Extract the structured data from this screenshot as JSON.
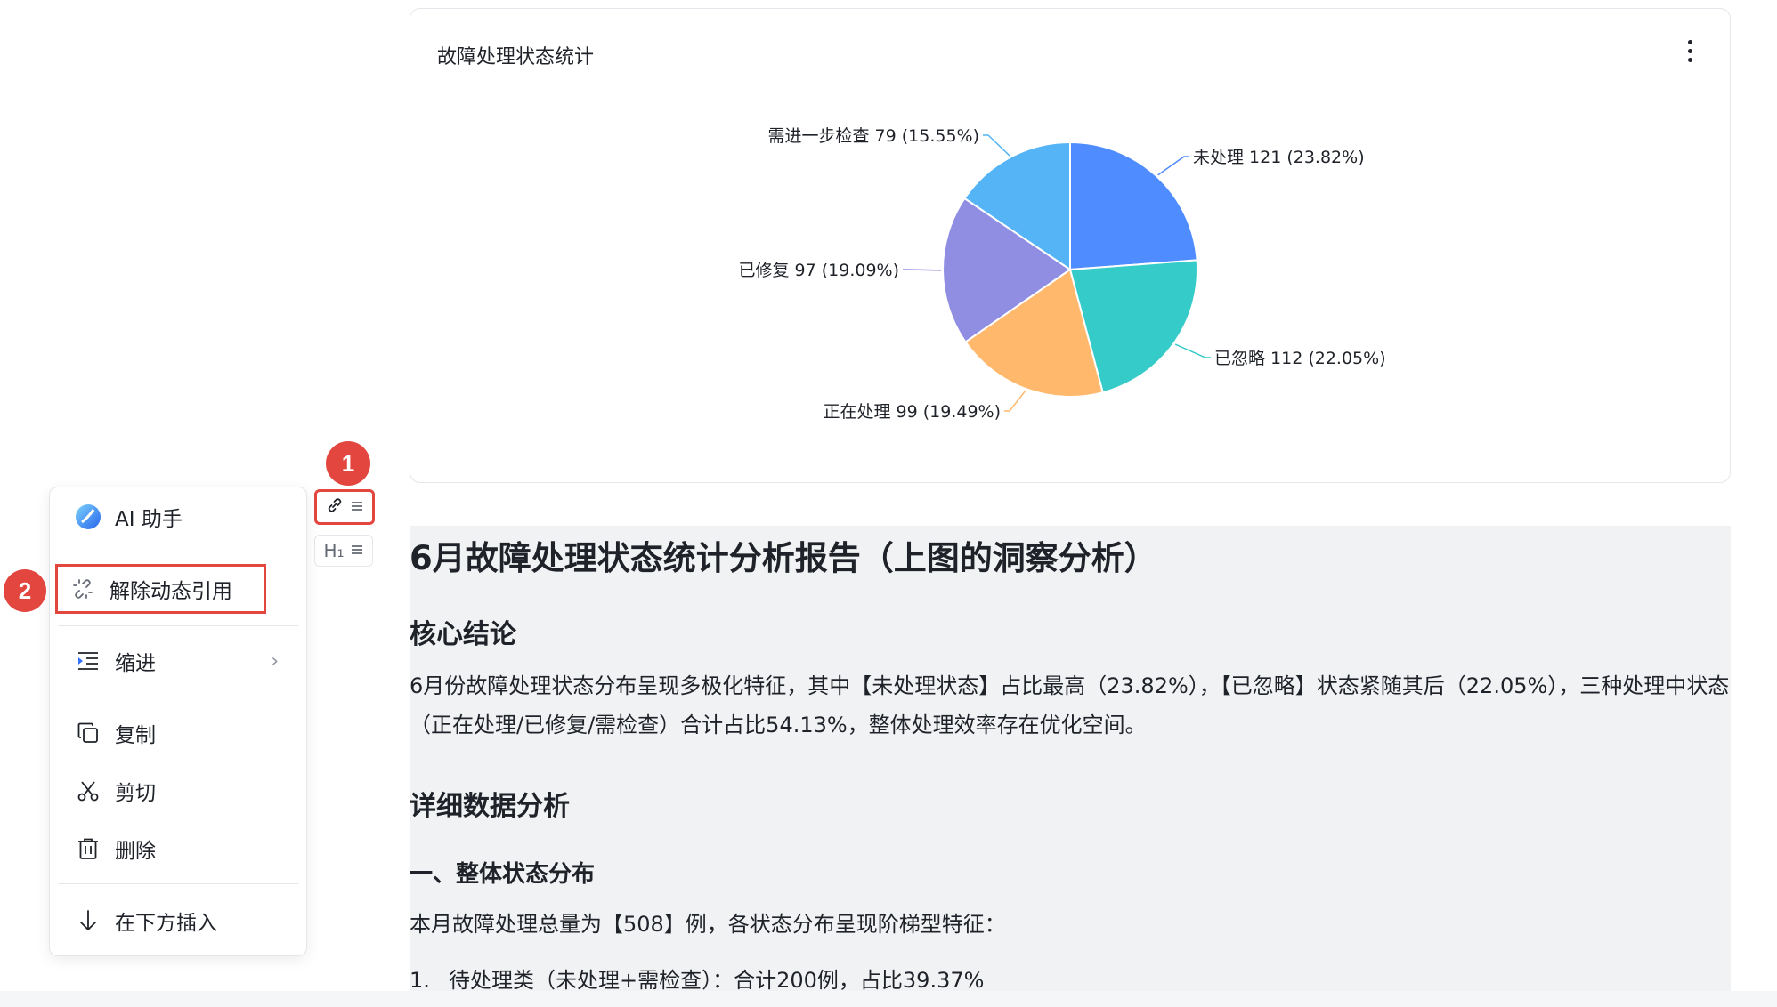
{
  "chart_card": {
    "title": "故障处理状态统计",
    "more_icon": "more-vertical-icon"
  },
  "chart_data": {
    "type": "pie",
    "title": "故障处理状态统计",
    "slices": [
      {
        "name": "未处理",
        "value": 121,
        "percent": "23.82%",
        "color": "#4e8cff",
        "label": "未处理 121 (23.82%)"
      },
      {
        "name": "已忽略",
        "value": 112,
        "percent": "22.05%",
        "color": "#35cbc9",
        "label": "已忽略 112 (22.05%)"
      },
      {
        "name": "正在处理",
        "value": 99,
        "percent": "19.49%",
        "color": "#ffb86c",
        "label": "正在处理 99 (19.49%)"
      },
      {
        "name": "已修复",
        "value": 97,
        "percent": "19.09%",
        "color": "#8f8ee3",
        "label": "已修复 97 (19.09%)"
      },
      {
        "name": "需进一步检查",
        "value": 79,
        "percent": "15.55%",
        "color": "#55b4f6",
        "label": "需进一步检查 79 (15.55%)"
      }
    ]
  },
  "handles": {
    "chart_handle_icons": [
      "link-icon",
      "drag-lines-icon"
    ],
    "heading_handle_label": "H₁",
    "heading_handle_icon": "drag-lines-icon",
    "badge1": "1",
    "badge2": "2"
  },
  "menu": {
    "ai_assistant": "AI 助手",
    "remove_dynamic_ref": "解除动态引用",
    "indent": "缩进",
    "copy": "复制",
    "cut": "剪切",
    "delete": "删除",
    "insert_below": "在下方插入"
  },
  "doc": {
    "h1": "6月故障处理状态统计分析报告（上图的洞察分析）",
    "section1_title": "核心结论",
    "section1_para": "6月份故障处理状态分布呈现多极化特征，其中【未处理状态】占比最高（23.82%），【已忽略】状态紧随其后（22.05%），三种处理中状态（正在处理/已修复/需检查）合计占比54.13%，整体处理效率存在优化空间。",
    "section2_title": "详细数据分析",
    "sub1_title": "一、整体状态分布",
    "sub1_para": "本月故障处理总量为【508】例，各状态分布呈现阶梯型特征：",
    "list": [
      {
        "num": "1.",
        "text": "待处理类（未处理+需检查）：合计200例，占比39.37%"
      }
    ]
  }
}
